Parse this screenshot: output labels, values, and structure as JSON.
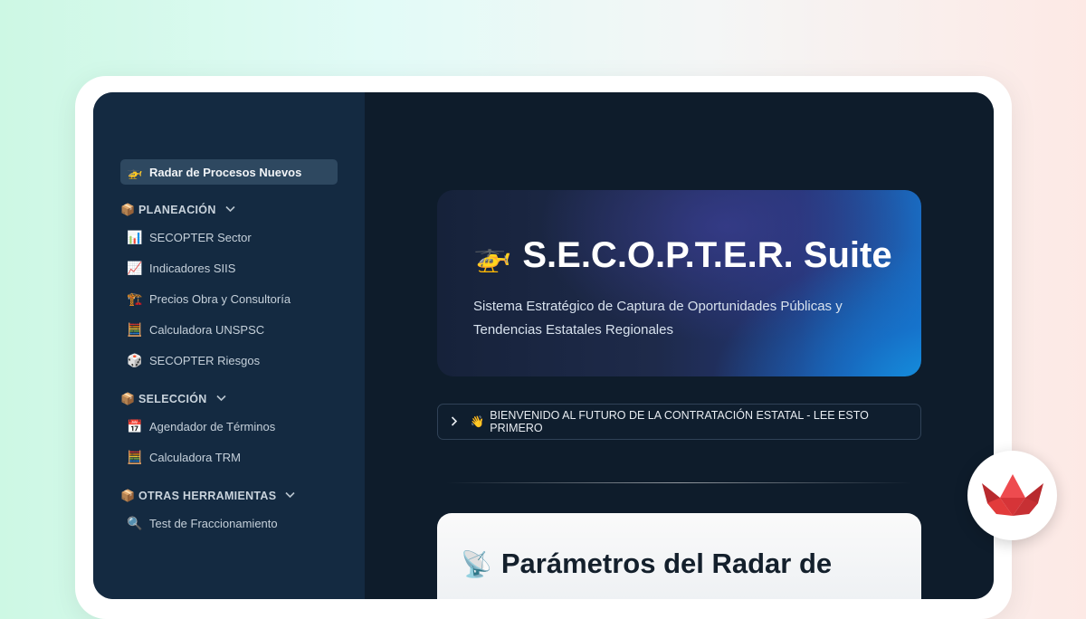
{
  "sidebar": {
    "active_item": {
      "icon": "🚁",
      "label": "Radar de Procesos Nuevos"
    },
    "sections": [
      {
        "icon": "📦",
        "label": "PLANEACIÓN",
        "items": [
          {
            "icon": "📊",
            "label": "SECOPTER Sector"
          },
          {
            "icon": "📈",
            "label": "Indicadores SIIS"
          },
          {
            "icon": "🏗️",
            "label": "Precios Obra y Consultoría"
          },
          {
            "icon": "🧮",
            "label": "Calculadora UNSPSC"
          },
          {
            "icon": "🎲",
            "label": "SECOPTER Riesgos"
          }
        ]
      },
      {
        "icon": "📦",
        "label": "SELECCIÓN",
        "items": [
          {
            "icon": "📅",
            "label": "Agendador de Términos"
          },
          {
            "icon": "🧮",
            "label": "Calculadora TRM"
          }
        ]
      },
      {
        "icon": "📦",
        "label": "OTRAS HERRAMIENTAS",
        "items": [
          {
            "icon": "🔍",
            "label": "Test de Fraccionamiento"
          }
        ]
      }
    ]
  },
  "hero": {
    "icon": "🚁",
    "title": "S.E.C.O.P.T.E.R. Suite",
    "subtitle": "Sistema Estratégico de Captura de Oportunidades Públicas y Tendencias Estatales Regionales"
  },
  "expander": {
    "icon": "👋",
    "label": "BIENVENIDO AL FUTURO DE LA CONTRATACIÓN ESTATAL - LEE ESTO PRIMERO"
  },
  "card": {
    "icon": "📡",
    "title": "Parámetros del Radar de"
  },
  "colors": {
    "sidebar_bg": "#142a41",
    "main_bg": "#0e1c2b",
    "active_item_bg": "#2e4860",
    "hero_accent": "#1495e0",
    "badge_red": "#e23b3b"
  }
}
